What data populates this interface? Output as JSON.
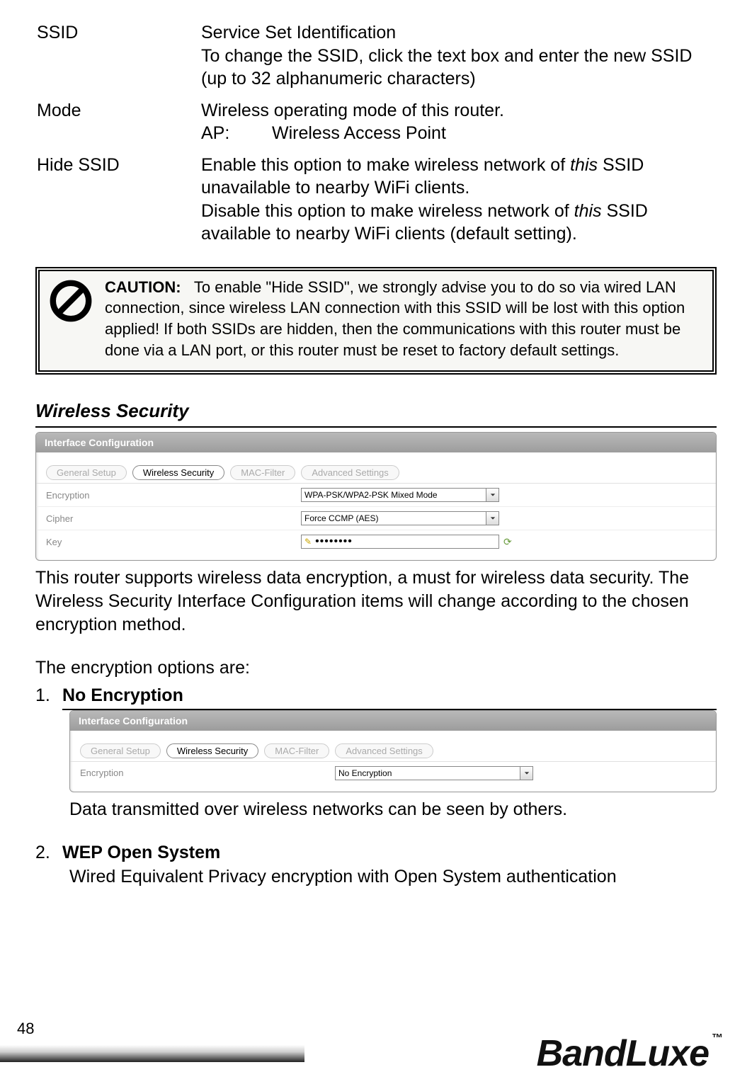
{
  "definitions": [
    {
      "term": "SSID",
      "lines": [
        "Service Set Identification",
        "To change the SSID, click the text box and enter the new SSID (up to 32 alphanumeric characters)"
      ]
    },
    {
      "term": "Mode",
      "lines": [
        "Wireless operating mode of this router."
      ],
      "sub": {
        "key": "AP:",
        "val": "Wireless Access Point"
      }
    },
    {
      "term": "Hide SSID",
      "hide_line1a": "Enable this option to make wireless network of ",
      "hide_line1_italic": "this",
      "hide_line1b": " SSID unavailable to nearby WiFi clients.",
      "hide_line2a": "Disable this option to make wireless network of ",
      "hide_line2_italic": "this",
      "hide_line2b": " SSID available to nearby WiFi clients (default setting)."
    }
  ],
  "caution": {
    "label": "CAUTION:",
    "text": "To enable \"Hide SSID\", we strongly advise you to do so via wired LAN connection, since wireless LAN connection with this SSID will be lost with this option applied! If both SSIDs are hidden, then the communications with this router must be done via a LAN port, or this router must be reset to factory default settings."
  },
  "section_title": "Wireless Security",
  "panel": {
    "header": "Interface Configuration",
    "tabs": [
      "General Setup",
      "Wireless Security",
      "MAC-Filter",
      "Advanced Settings"
    ],
    "active_tab_index": 1,
    "rows": {
      "encryption_label": "Encryption",
      "encryption_value": "WPA-PSK/WPA2-PSK Mixed Mode",
      "cipher_label": "Cipher",
      "cipher_value": "Force CCMP (AES)",
      "key_label": "Key",
      "key_value": "••••••••"
    }
  },
  "para1": "This router supports wireless data encryption, a must for wireless data security. The Wireless Security Interface Configuration items will change according to the chosen encryption method.",
  "para2": "The encryption options are:",
  "options": [
    {
      "num": "1.",
      "title": "No Encryption",
      "panel": {
        "header": "Interface Configuration",
        "tabs": [
          "General Setup",
          "Wireless Security",
          "MAC-Filter",
          "Advanced Settings"
        ],
        "active_tab_index": 1,
        "encryption_label": "Encryption",
        "encryption_value": "No Encryption"
      },
      "desc": "Data transmitted over wireless networks can be seen by others."
    },
    {
      "num": "2.",
      "title": "WEP Open System",
      "desc": "Wired Equivalent Privacy encryption with Open System authentication"
    }
  ],
  "page_number": "48",
  "brand": "BandLuxe",
  "brand_tm": "™"
}
